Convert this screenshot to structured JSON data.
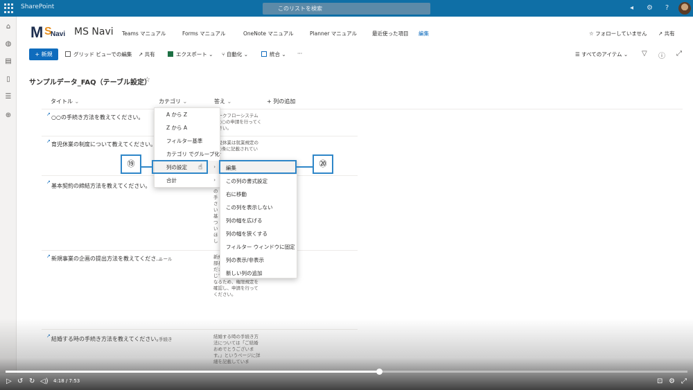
{
  "suitebar": {
    "brand": "SharePoint",
    "search_placeholder": "このリストを検索"
  },
  "site": {
    "logo_text": {
      "m": "M",
      "s": "S",
      "navi": "Navi"
    },
    "title": "MS Navi",
    "nav": [
      "Teams マニュアル",
      "Forms マニュアル",
      "OneNote マニュアル",
      "Planner マニュアル",
      "最近使った項目",
      "編集"
    ],
    "follow": "☆ フォローしていません",
    "share": "共有"
  },
  "commandbar": {
    "new": "新規",
    "grid_edit": "グリッド ビューでの編集",
    "share": "共有",
    "export": "エクスポート",
    "automate": "自動化",
    "integrate": "統合",
    "more": "···",
    "view": "すべてのアイテム"
  },
  "list": {
    "title": "サンプルデータ_FAQ（テーブル設定）",
    "columns": [
      "タイトル",
      "カテゴリ",
      "答え",
      "+ 列の追加"
    ],
    "rows": [
      {
        "title": "○○の手続き方法を教えてください。",
        "category": "",
        "answer": "ワークフローシステムで○○の申請を行ってください。"
      },
      {
        "title": "育児休業の制度について教えてください。",
        "category": "",
        "answer": "育児休業は就業規定の第○条に記載されています"
      },
      {
        "title": "基本契約の締結方法を教えてください。",
        "category": "",
        "answer": "の手さい・基ついほし・フムでいく"
      },
      {
        "title": "新規事業の企画の提出方法を教えてくださ...",
        "category": "ルール",
        "answer": "新規の手きい・事し、部長の承認を受けてください。・投資規模に応じて、申請ルートが異なるため、権限規定を確認し、申請を行ってください。"
      },
      {
        "title": "結婚する時の手続き方法を教えてください。",
        "category": "手続き",
        "answer": "結婚する時の手続き方法については「ご結婚おめでとうございます。」というページに詳細を記載していま"
      }
    ]
  },
  "menu_category": [
    "A から Z",
    "Z から A",
    "フィルター基準",
    "カテゴリ でグループ化",
    "列の設定",
    "合計"
  ],
  "menu_column_settings": [
    "編集",
    "この列の書式設定",
    "右に移動",
    "この列を表示しない",
    "列の幅を広げる",
    "列の幅を狭くする",
    "フィルター ウィンドウに固定",
    "列の表示/非表示",
    "新しい列の追加"
  ],
  "callouts": {
    "c19": "⑲",
    "c20": "⑳"
  },
  "video": {
    "time": "4:18 / 7:53",
    "progress": 0.548
  },
  "colors": {
    "accent": "#0f6cbd",
    "suitebar": "#0f6fa6",
    "callout": "#2e86c8"
  }
}
